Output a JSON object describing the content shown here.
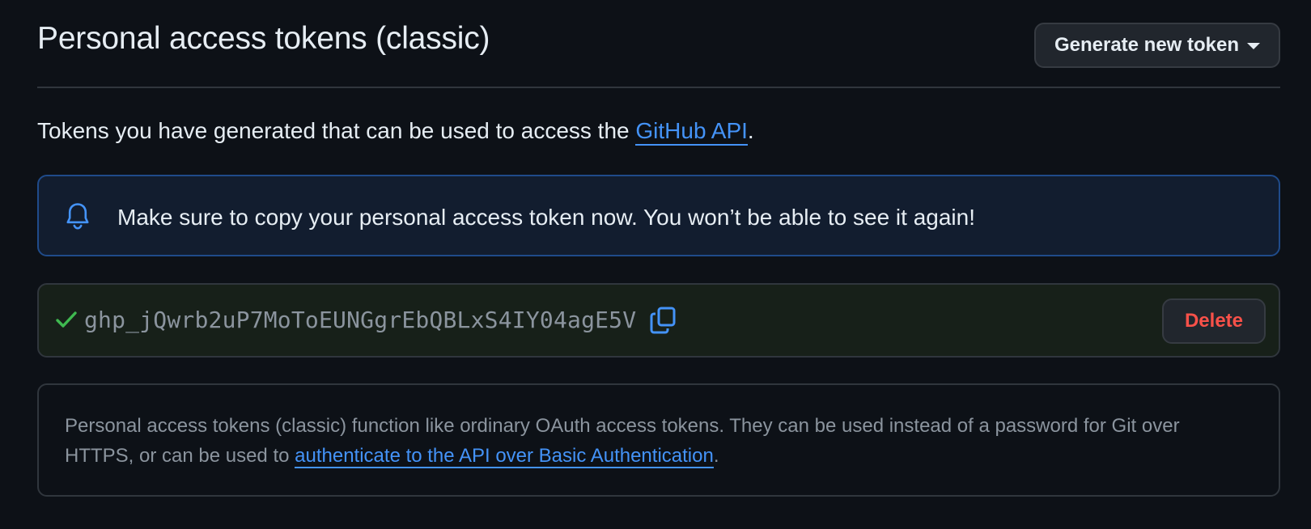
{
  "header": {
    "title": "Personal access tokens (classic)",
    "generate_button_label": "Generate new token"
  },
  "intro": {
    "text_before": "Tokens you have generated that can be used to access the ",
    "link_text": "GitHub API",
    "text_after": "."
  },
  "flash": {
    "icon": "bell-icon",
    "message": "Make sure to copy your personal access token now. You won’t be able to see it again!"
  },
  "token": {
    "status_icon": "check-icon",
    "value": "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",
    "copy_icon": "copy-icon",
    "delete_label": "Delete"
  },
  "info": {
    "text_before": "Personal access tokens (classic) function like ordinary OAuth access tokens. They can be used instead of a password for Git over HTTPS, or can be used to ",
    "link_text": "authenticate to the API over Basic Authentication",
    "text_after": "."
  },
  "colors": {
    "background": "#0d1117",
    "link": "#4493f8",
    "danger": "#f85149",
    "success": "#3fb950",
    "flash_border": "#1f4b8a"
  }
}
